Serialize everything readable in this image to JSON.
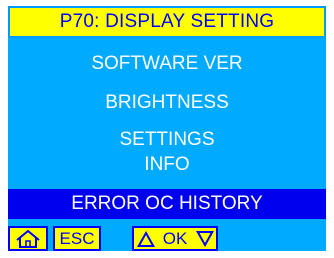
{
  "header": {
    "title": "P70: DISPLAY SETTING"
  },
  "menu": {
    "items": [
      {
        "label": "SOFTWARE VER"
      },
      {
        "label": "BRIGHTNESS"
      },
      {
        "label": "SETTINGS"
      },
      {
        "label": "INFO"
      },
      {
        "label": "ERROR OC HISTORY",
        "selected": true
      }
    ]
  },
  "footer": {
    "home_icon": "home-icon",
    "esc_label": "ESC",
    "up_icon": "up-triangle-icon",
    "ok_label": "OK",
    "down_icon": "down-triangle-icon"
  },
  "colors": {
    "title_bg": "#ffff00",
    "title_text": "#0000ff",
    "screen_bg": "#00aaff",
    "selected_bg": "#0000ee",
    "item_text": "#ffffff"
  }
}
